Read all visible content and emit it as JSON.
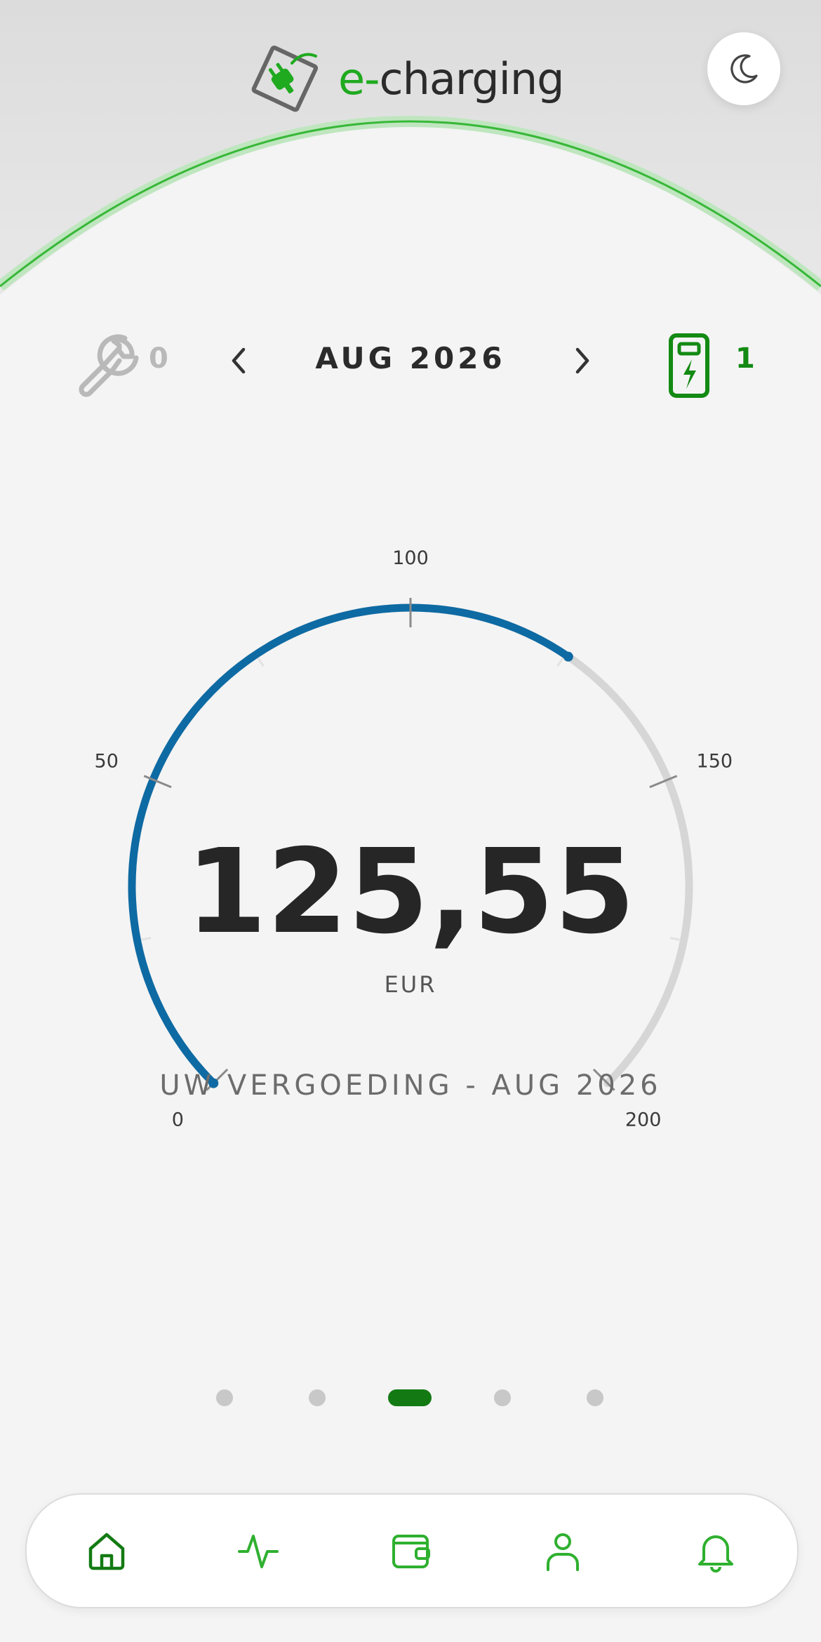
{
  "header": {
    "app_name_prefix": "e-",
    "app_name_suffix": "charging",
    "brand_color": "#1faa1f",
    "theme_toggle_icon": "moon-icon"
  },
  "stats": {
    "maintenance_icon": "wrench-icon",
    "maintenance_count": "0",
    "period_label": "AUG 2026",
    "charger_icon": "charging-station-icon",
    "charger_count": "1"
  },
  "gauge": {
    "value_text": "125,55",
    "unit": "EUR",
    "value": 125.55,
    "min": 0,
    "max": 200,
    "tick_labels": [
      "0",
      "50",
      "100",
      "150",
      "200"
    ],
    "progress_color": "#0e6aa3",
    "track_color": "#d6d6d6",
    "caption": "UW VERGOEDING - AUG 2026"
  },
  "pager": {
    "count": 5,
    "active_index": 2
  },
  "bottom_nav": {
    "items": [
      {
        "icon": "home-icon",
        "active": true
      },
      {
        "icon": "activity-icon",
        "active": false
      },
      {
        "icon": "wallet-icon",
        "active": false
      },
      {
        "icon": "user-icon",
        "active": false
      },
      {
        "icon": "bell-icon",
        "active": false
      }
    ]
  }
}
